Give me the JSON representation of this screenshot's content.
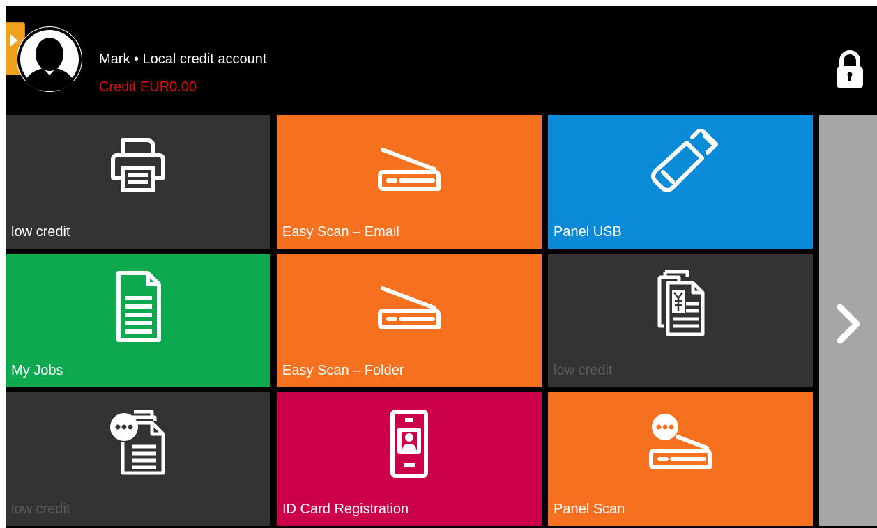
{
  "header": {
    "user_line": "Mark • Local credit account",
    "credit_line": "Credit EUR0.00",
    "icons": {
      "expand": "expand-panel-icon",
      "avatar": "user-avatar-icon",
      "lock": "lock-icon"
    }
  },
  "tiles": [
    {
      "label": "low credit",
      "icon": "printer-icon",
      "color": "#333333",
      "enabled": false
    },
    {
      "label": "Easy Scan – Email",
      "icon": "scanner-icon",
      "color": "#f57120",
      "enabled": true
    },
    {
      "label": "Panel USB",
      "icon": "usb-drive-icon",
      "color": "#0b8ad8",
      "enabled": true
    },
    {
      "label": "My Jobs",
      "icon": "document-icon",
      "color": "#0ea84e",
      "enabled": true
    },
    {
      "label": "Easy Scan – Folder",
      "icon": "scanner-icon",
      "color": "#f57120",
      "enabled": true
    },
    {
      "label": "low credit",
      "icon": "yen-documents-icon",
      "color": "#333333",
      "enabled": false
    },
    {
      "label": "low credit",
      "icon": "documents-chat-icon",
      "color": "#333333",
      "enabled": false
    },
    {
      "label": "ID Card Registration",
      "icon": "id-card-icon",
      "color": "#cc004a",
      "enabled": true
    },
    {
      "label": "Panel Scan",
      "icon": "scanner-chat-icon",
      "color": "#f57120",
      "enabled": true
    }
  ],
  "navigation": {
    "next_icon": "chevron-right-icon",
    "color": "#a6a6a6"
  }
}
